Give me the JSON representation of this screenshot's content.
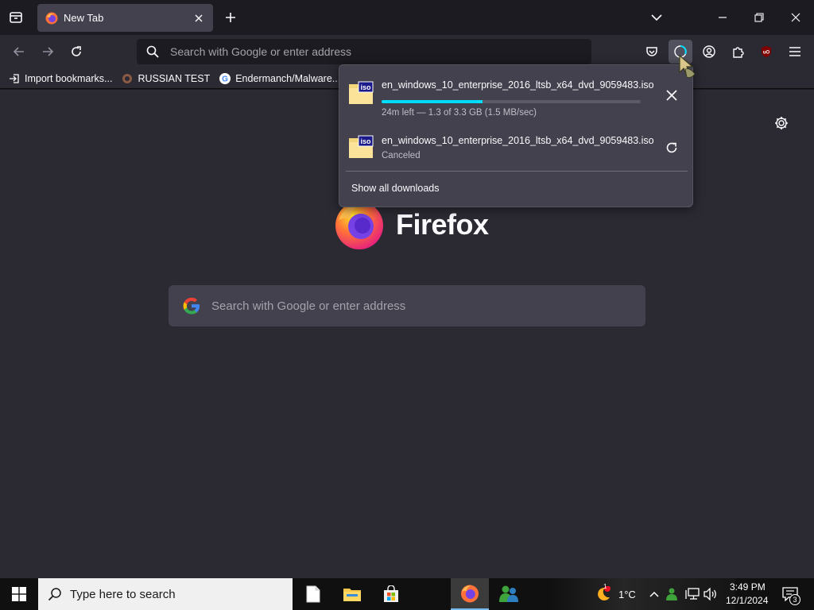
{
  "tab": {
    "title": "New Tab"
  },
  "navbar": {
    "url_placeholder": "Search with Google or enter address"
  },
  "bookmarks": [
    {
      "label": "Import bookmarks..."
    },
    {
      "label": "RUSSIAN TEST"
    },
    {
      "label": "Endermanch/Malware..."
    }
  ],
  "newtab": {
    "brand": "Firefox",
    "search_placeholder": "Search with Google or enter address"
  },
  "downloads": {
    "items": [
      {
        "filename": "en_windows_10_enterprise_2016_ltsb_x64_dvd_9059483.iso",
        "status": "24m left — 1.3 of 3.3 GB (1.5 MB/sec)",
        "icon_label": "iso",
        "progress": 0.39,
        "action": "cancel"
      },
      {
        "filename": "en_windows_10_enterprise_2016_ltsb_x64_dvd_9059483.iso",
        "status": "Canceled",
        "icon_label": "iso",
        "action": "retry"
      }
    ],
    "show_all": "Show all downloads"
  },
  "taskbar": {
    "search_placeholder": "Type here to search",
    "weather": "1°C",
    "weather_badge": "1",
    "time": "3:49 PM",
    "date": "12/1/2024",
    "notification_count": "3"
  },
  "colors": {
    "accent": "#00ddff",
    "toolbar": "#2b2a33",
    "tabstrip": "#1c1b22",
    "panel": "#42414d"
  }
}
